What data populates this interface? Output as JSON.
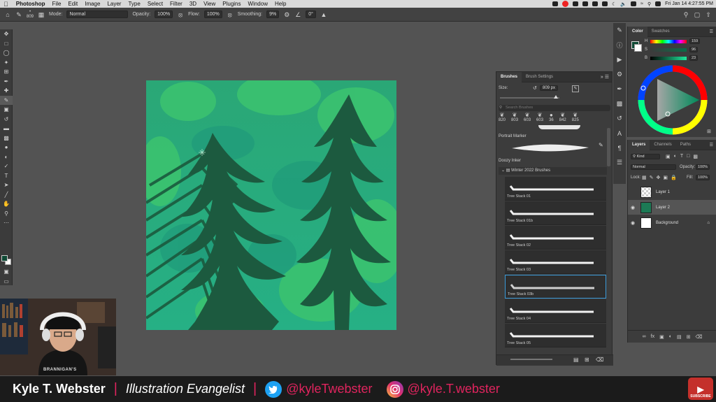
{
  "menubar": {
    "app": "Photoshop",
    "items": [
      "File",
      "Edit",
      "Image",
      "Layer",
      "Type",
      "Select",
      "Filter",
      "3D",
      "View",
      "Plugins",
      "Window",
      "Help"
    ],
    "datetime": "Fri Jan 14  4:27:55 PM"
  },
  "options": {
    "brush_size": "809",
    "mode_label": "Mode:",
    "mode_value": "Normal",
    "opacity_label": "Opacity:",
    "opacity_value": "100%",
    "flow_label": "Flow:",
    "flow_value": "100%",
    "smoothing_label": "Smoothing:",
    "smoothing_value": "9%",
    "angle_value": "0°"
  },
  "brushes": {
    "tabs": [
      "Brushes",
      "Brush Settings"
    ],
    "size_label": "Size:",
    "size_value": "809 px",
    "search_placeholder": "Search Brushes",
    "recent_sizes": [
      "820",
      "803",
      "603",
      "603",
      "36",
      "842",
      "825"
    ],
    "portrait_marker": "Portrait Marker",
    "doozy_inker": "Doozy Inker",
    "group_name": "Winter 2022 Brushes",
    "items": [
      {
        "label": "Tree Stack 01"
      },
      {
        "label": "Tree Stack 01b"
      },
      {
        "label": "Tree Stack 02"
      },
      {
        "label": "Tree Stack 03"
      },
      {
        "label": "Tree Stack 03b",
        "selected": true
      },
      {
        "label": "Tree Stack 04"
      },
      {
        "label": "Tree Stack 05"
      }
    ]
  },
  "color": {
    "tabs": [
      "Color",
      "Swatches"
    ],
    "h_label": "H",
    "s_label": "S",
    "b_label": "B",
    "h_value": "159",
    "s_value": "96",
    "b_value": "23",
    "foreground": "#0f4a35"
  },
  "layers": {
    "tabs": [
      "Layers",
      "Channels",
      "Paths"
    ],
    "kind_label": "Kind",
    "blend_mode": "Normal",
    "opacity_label": "Opacity:",
    "opacity_value": "100%",
    "lock_label": "Lock:",
    "fill_label": "Fill:",
    "fill_value": "100%",
    "rows": [
      {
        "name": "Layer 1",
        "visible": false
      },
      {
        "name": "Layer 2",
        "visible": true,
        "selected": true
      },
      {
        "name": "Background",
        "visible": true,
        "locked": true
      }
    ]
  },
  "lowerthird": {
    "name": "Kyle T. Webster",
    "title": "Illustration Evangelist",
    "twitter": "@kyleTwebster",
    "instagram": "@kyle.T.webster",
    "subscribe": "SUBSCRIBE"
  },
  "webcam": {
    "shirt_text": "BRANNIGAN'S"
  }
}
